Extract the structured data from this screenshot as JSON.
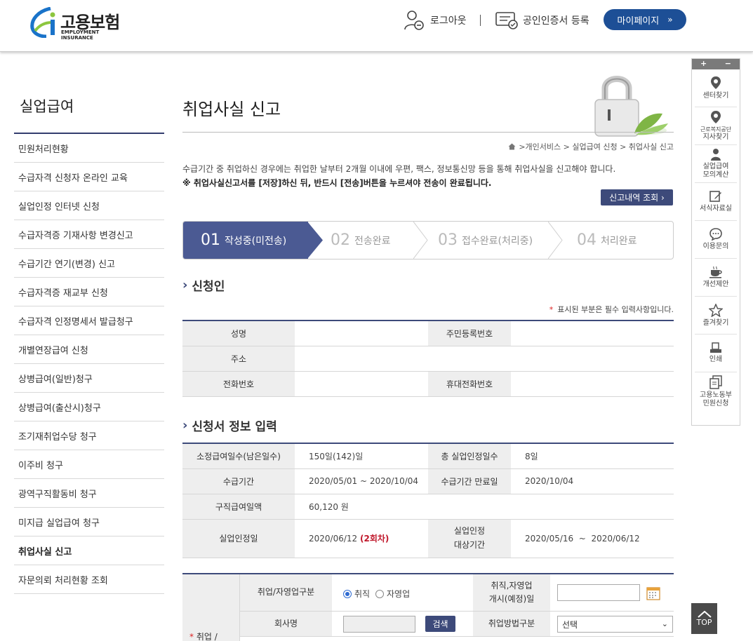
{
  "header": {
    "logo_title": "고용보험",
    "logo_sub": "EMPLOYMENT INSURANCE",
    "logout": "로그아웃",
    "cert_register": "공인인증서 등록",
    "mypage": "마이페이지"
  },
  "lnb": {
    "title": "실업급여",
    "items": [
      "민원처리현황",
      "수급자격 신청자 온라인 교육",
      "실업인정 인터넷 신청",
      "수급자격증 기재사항 변경신고",
      "수급기간 연기(변경) 신고",
      "수급자격증 재교부 신청",
      "수급자격 인정명세서 발급청구",
      "개별연장급여 신청",
      "상병급여(일반)청구",
      "상병급여(출산시)청구",
      "조기재취업수당 청구",
      "이주비 청구",
      "광역구직활동비 청구",
      "미지급 실업급여 청구",
      "취업사실 신고",
      "자문의뢰 처리현황 조회"
    ]
  },
  "main": {
    "title": "취업사실 신고",
    "breadcrumb": ">개인서비스 > 실업급여 신청 > 취업사실 신고",
    "notice1": "수급기간 중 취업하신 경우에는 취업한 날부터 2개월 이내에 우편, 팩스, 정보통신망 등을 통해 취업사실을 신고해야 합니다.",
    "notice2": "※ 취업사실신고서를 [저장]하신 뒤, 반드시 [전송]버튼을 누르셔야 전송이 완료됩니다.",
    "history_btn": "신고내역 조회 ›"
  },
  "steps": [
    {
      "num": "01",
      "label": "작성중(미전송)"
    },
    {
      "num": "02",
      "label": "전송완료"
    },
    {
      "num": "03",
      "label": "접수완료(처리중)"
    },
    {
      "num": "04",
      "label": "처리완료"
    }
  ],
  "applicant": {
    "section_title": "신청인",
    "required_note": "표시된 부분은 필수 입력사항입니다.",
    "name_label": "성명",
    "rrn_label": "주민등록번호",
    "address_label": "주소",
    "phone_label": "전화번호",
    "mobile_label": "휴대전화번호"
  },
  "form_info": {
    "section_title": "신청서 정보 입력",
    "days_label": "소정급여일수(남은일수)",
    "days_value": "150일(142)일",
    "total_days_label": "총 실업인정일수",
    "total_days_value": "8일",
    "period_label": "수급기간",
    "period_value": "2020/05/01 ~ 2020/10/04",
    "period_end_label": "수급기간 만료일",
    "period_end_value": "2020/10/04",
    "daily_label": "구직급여일액",
    "daily_value": "60,120 원",
    "cert_date_label": "실업인정일",
    "cert_date_value": "2020/06/12",
    "cert_round": "(2회차)",
    "cert_period_label_1": "실업인정",
    "cert_period_label_2": "대상기간",
    "cert_period_value": "2020/05/16  ~  2020/06/12"
  },
  "entry": {
    "left_label": "취업 /",
    "type_label": "취업/자영업구분",
    "radio_employ": "취직",
    "radio_self": "자영업",
    "start_label_1": "취직,자영업",
    "start_label_2": "개시(예정)일",
    "company_label": "회사명",
    "search_btn": "검색",
    "method_label": "취업방법구분",
    "method_value": "선택"
  },
  "quick": {
    "plus": "+",
    "minus": "−",
    "items": [
      {
        "icon": "location-pin-icon",
        "line1": "센터찾기",
        "line2": ""
      },
      {
        "icon": "location-pin-icon",
        "line1": "근로복지공단",
        "line2": "지사찾기"
      },
      {
        "icon": "person-icon",
        "line1": "실업급여",
        "line2": "모의계산"
      },
      {
        "icon": "edit-icon",
        "line1": "서식자료실",
        "line2": ""
      },
      {
        "icon": "chat-icon",
        "line1": "이용문의",
        "line2": ""
      },
      {
        "icon": "coffee-icon",
        "line1": "개선제안",
        "line2": ""
      },
      {
        "icon": "star-icon",
        "line1": "즐겨찾기",
        "line2": ""
      },
      {
        "icon": "print-icon",
        "line1": "인쇄",
        "line2": ""
      },
      {
        "icon": "document-icon",
        "line1": "고용노동부",
        "line2": "민원신청"
      }
    ],
    "top": "TOP"
  }
}
